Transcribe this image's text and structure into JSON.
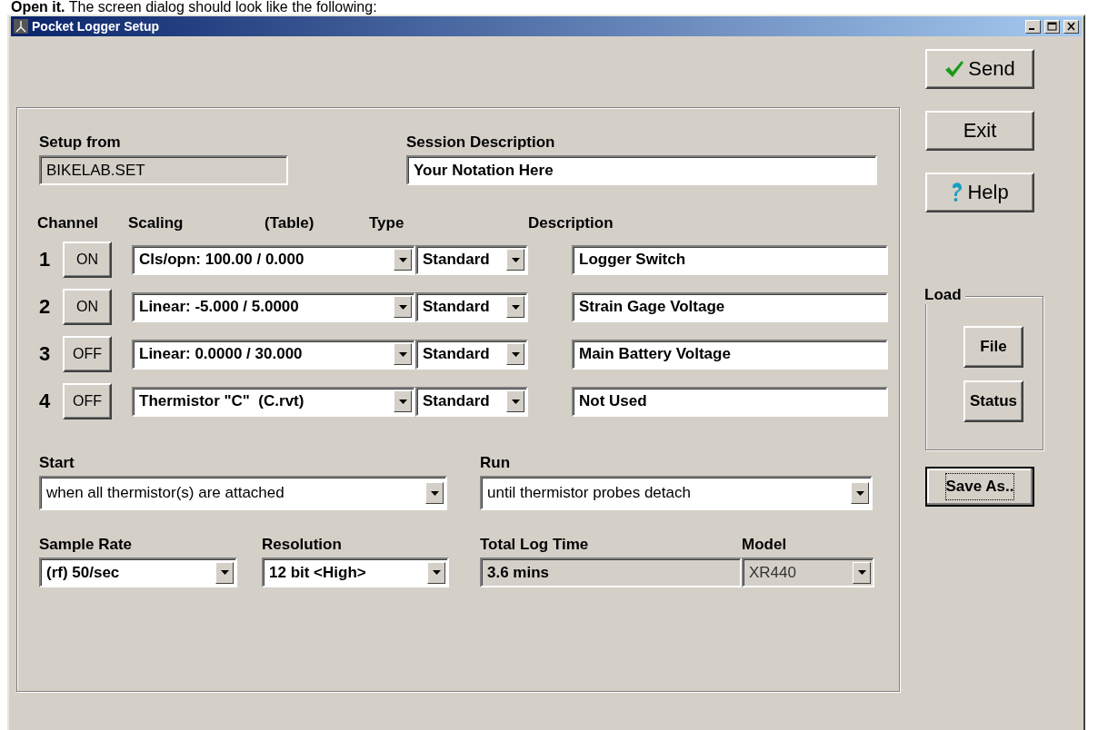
{
  "caption": "**Open it.** The screen dialog should look like the following:",
  "window": {
    "title": "Pocket Logger Setup"
  },
  "setup_from": {
    "label": "Setup from",
    "value": "BIKELAB.SET"
  },
  "session": {
    "label": "Session Description",
    "value": "Your Notation Here"
  },
  "channel_headers": [
    "Channel",
    "Scaling",
    "(Table)",
    "Type",
    "Description"
  ],
  "channels": [
    {
      "number": "1",
      "toggle": "ON",
      "scaling": "Cls/opn: 100.00 / 0.000",
      "type": "Standard",
      "description": "Logger Switch"
    },
    {
      "number": "2",
      "toggle": "ON",
      "scaling": "Linear: -5.000 / 5.0000",
      "type": "Standard",
      "description": "Strain Gage Voltage"
    },
    {
      "number": "3",
      "toggle": "OFF",
      "scaling": "Linear: 0.0000 / 30.000",
      "type": "Standard",
      "description": "Main Battery Voltage"
    },
    {
      "number": "4",
      "toggle": "OFF",
      "scaling": "Thermistor \"C\"  (C.rvt)",
      "type": "Standard",
      "description": "Not Used"
    }
  ],
  "start": {
    "label": "Start",
    "value": "when all thermistor(s) are attached"
  },
  "run": {
    "label": "Run",
    "value": "until thermistor probes detach"
  },
  "sample_rate": {
    "label": "Sample Rate",
    "value": "(rf) 50/sec"
  },
  "resolution": {
    "label": "Resolution",
    "value": "12 bit <High>"
  },
  "total_log_time": {
    "label": "Total Log Time",
    "value": "3.6 mins"
  },
  "model": {
    "label": "Model",
    "value": "XR440",
    "disabled": true
  },
  "side_buttons": [
    {
      "label": "Send",
      "kind": "check"
    },
    {
      "label": "Exit",
      "kind": "plain"
    },
    {
      "label": "Help",
      "kind": "question"
    }
  ],
  "load": {
    "label": "Load",
    "buttons": [
      "File",
      "Status"
    ]
  },
  "save_as": {
    "label": "Save As..",
    "focused": true
  }
}
